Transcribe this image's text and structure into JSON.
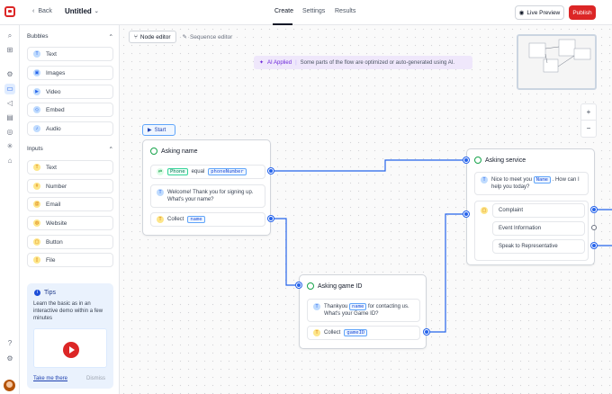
{
  "header": {
    "back_label": "Back",
    "title": "Untitled",
    "tabs": [
      "Create",
      "Settings",
      "Results"
    ],
    "live_preview": "Live Preview",
    "publish": "Publish"
  },
  "sidebar": {
    "bubbles_title": "Bubbles",
    "bubbles": [
      "Text",
      "Images",
      "Video",
      "Embed",
      "Audio"
    ],
    "inputs_title": "Inputs",
    "inputs": [
      "Text",
      "Number",
      "Email",
      "Website",
      "Button",
      "File"
    ],
    "tips": {
      "title": "Tips",
      "text": "Learn the basic as in an interactive demo within a few minutes",
      "take_tour": "Take me there",
      "dismiss": "Dismiss"
    }
  },
  "canvas": {
    "editor_tabs": [
      "Node editor",
      "Sequence editor"
    ],
    "ai_banner": {
      "label": "AI Applied",
      "text": "Some parts of the flow are optimized or auto-generated using AI."
    },
    "start_label": "Start",
    "zoom_in": "+",
    "zoom_out": "−"
  },
  "nodes": {
    "asking_name": {
      "title": "Asking name",
      "cond_var": "Phone",
      "cond_op": "equal",
      "cond_val": "phoneNumber",
      "message": "Welcome! Thank you for signing up. What's your name?",
      "collect_label": "Collect",
      "collect_var": "name"
    },
    "asking_service": {
      "title": "Asking service",
      "message_pre": "Nice to meet you",
      "message_var": "Name",
      "message_post": "How can I help you today?",
      "options": [
        "Complaint",
        "Event Information",
        "Speak to Representative"
      ]
    },
    "asking_game": {
      "title": "Asking game ID",
      "message_pre": "Thankyou",
      "message_var": "name",
      "message_post": "for contacting us. What's your Game ID?",
      "collect_label": "Collect",
      "collect_var": "gameID"
    }
  },
  "colors": {
    "accent": "#2563eb",
    "brand": "#dc2626",
    "ai": "#6d28d9"
  }
}
